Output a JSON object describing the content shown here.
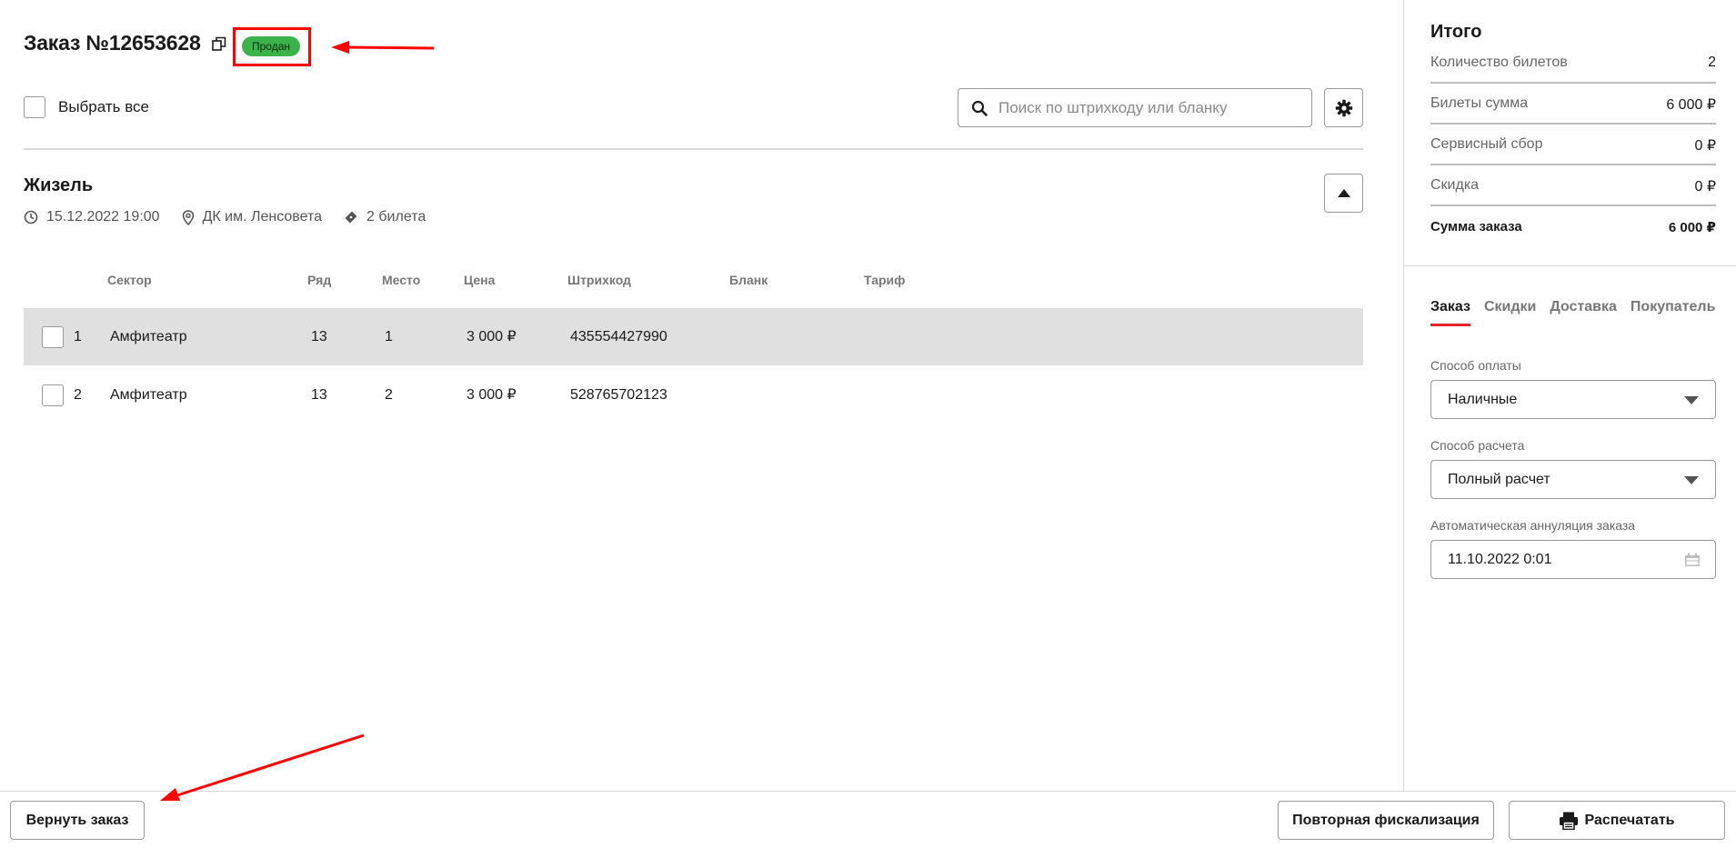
{
  "order": {
    "title": "Заказ №12653628",
    "status": "Продан"
  },
  "toolbar": {
    "select_all_label": "Выбрать все",
    "search_placeholder": "Поиск по штрихкоду или бланку"
  },
  "event": {
    "title": "Жизель",
    "datetime": "15.12.2022 19:00",
    "venue": "ДК им. Ленсовета",
    "tickets_count": "2 билета"
  },
  "table": {
    "headers": {
      "sector": "Сектор",
      "row": "Ряд",
      "seat": "Место",
      "price": "Цена",
      "barcode": "Штрихкод",
      "blank": "Бланк",
      "tariff": "Тариф"
    },
    "rows": [
      {
        "num": "1",
        "sector": "Амфитеатр",
        "row": "13",
        "seat": "1",
        "price": "3 000 ₽",
        "barcode": "435554427990"
      },
      {
        "num": "2",
        "sector": "Амфитеатр",
        "row": "13",
        "seat": "2",
        "price": "3 000 ₽",
        "barcode": "528765702123"
      }
    ]
  },
  "summary": {
    "title": "Итого",
    "rows": [
      {
        "label": "Количество билетов",
        "value": "2"
      },
      {
        "label": "Билеты сумма",
        "value": "6 000 ₽"
      },
      {
        "label": "Сервисный сбор",
        "value": "0 ₽"
      },
      {
        "label": "Скидка",
        "value": "0 ₽"
      }
    ],
    "total_label": "Сумма заказа",
    "total_value": "6 000 ₽"
  },
  "tabs": [
    "Заказ",
    "Скидки",
    "Доставка",
    "Покупатель"
  ],
  "fields": {
    "payment_label": "Способ оплаты",
    "payment_value": "Наличные",
    "settlement_label": "Способ расчета",
    "settlement_value": "Полный расчет",
    "auto_cancel_label": "Автоматическая аннуляция заказа",
    "auto_cancel_value": "11.10.2022 0:01"
  },
  "bottom": {
    "return_label": "Вернуть заказ",
    "refiscal_label": "Повторная фискализация",
    "print_label": "Распечатать"
  },
  "colors": {
    "status_green": "#3bb34a",
    "accent_red": "#e5252a",
    "annotation_red": "#ff0000",
    "row_highlight": "#e0e0e0"
  }
}
